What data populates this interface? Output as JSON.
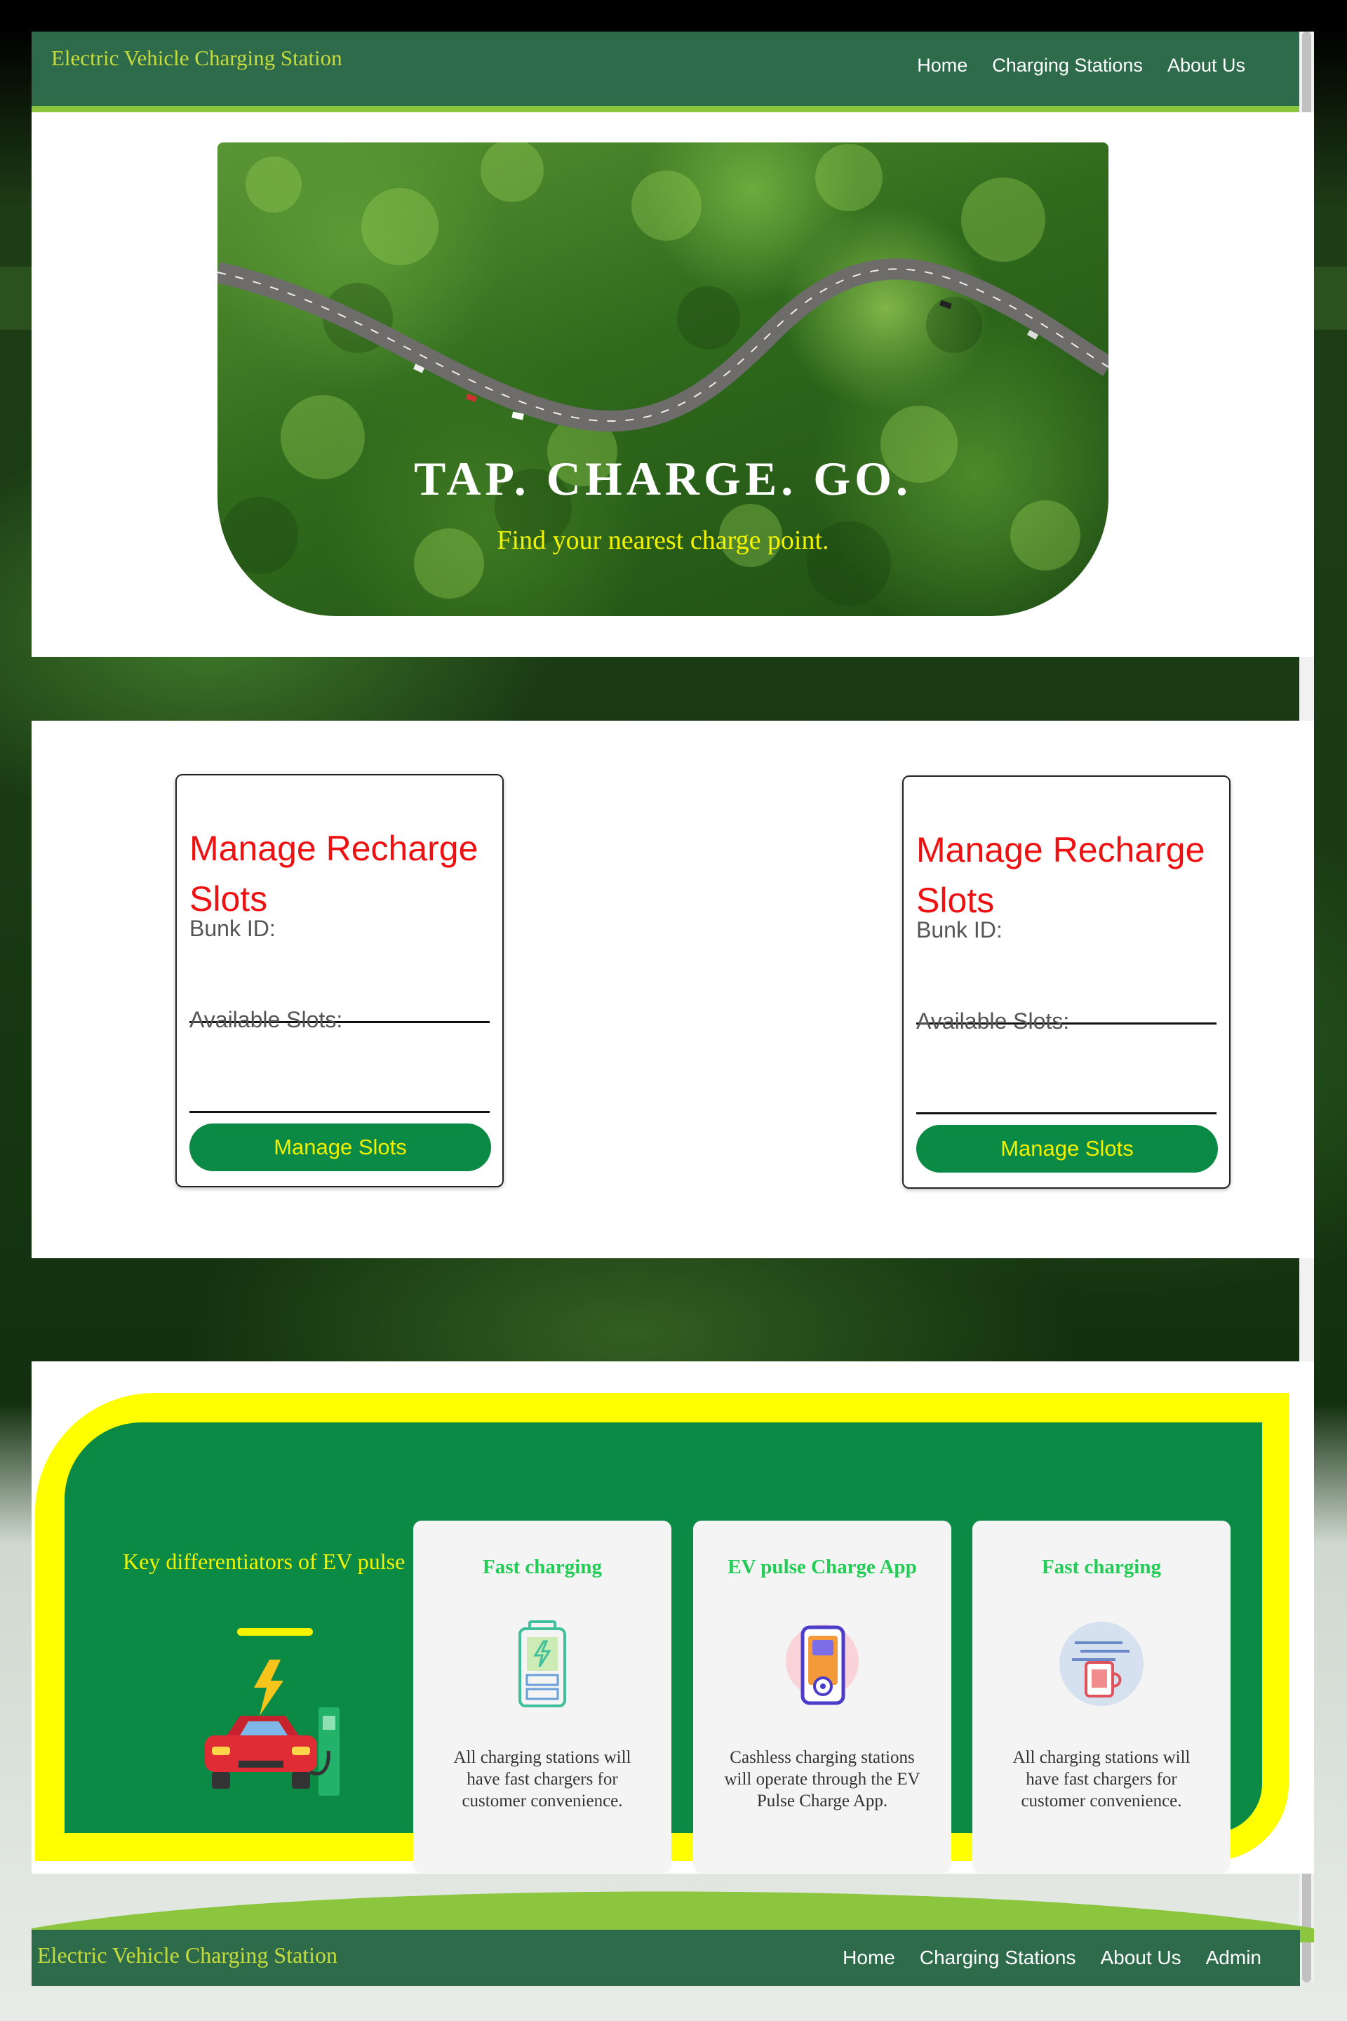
{
  "header": {
    "brand": "Electric Vehicle Charging Station",
    "nav": [
      "Home",
      "Charging Stations",
      "About Us"
    ]
  },
  "hero": {
    "title": "TAP. CHARGE. GO.",
    "subtitle": "Find your nearest charge point."
  },
  "slots": [
    {
      "title": "Manage Recharge Slots",
      "bunk_label": "Bunk ID:",
      "available_label": "Available Slots:",
      "button": "Manage Slots"
    },
    {
      "title": "Manage Recharge Slots",
      "bunk_label": "Bunk ID:",
      "available_label": "Available Slots:",
      "button": "Manage Slots"
    }
  ],
  "differentiators": {
    "heading": "Key differentiators of EV pulse",
    "cards": [
      {
        "title": "Fast charging",
        "icon": "battery-icon",
        "text": "All charging stations will have fast chargers for customer convenience."
      },
      {
        "title": "EV pulse Charge App",
        "icon": "phone-app-icon",
        "text": "Cashless charging stations will operate through the EV Pulse Charge App."
      },
      {
        "title": "Fast charging",
        "icon": "fast-charger-icon",
        "text": "All charging stations will have fast chargers for customer convenience."
      }
    ]
  },
  "footer": {
    "brand": "Electric Vehicle Charging Station",
    "nav": [
      "Home",
      "Charging Stations",
      "About Us",
      "Admin"
    ]
  },
  "colors": {
    "header_bg": "#2e6b4a",
    "accent_lime": "#8cc63f",
    "brand_text": "#c6dc3c",
    "slot_title": "#ee1111",
    "button_green": "#0a8a44",
    "button_text": "#f0f000",
    "diff_yellow": "#ffff00"
  }
}
